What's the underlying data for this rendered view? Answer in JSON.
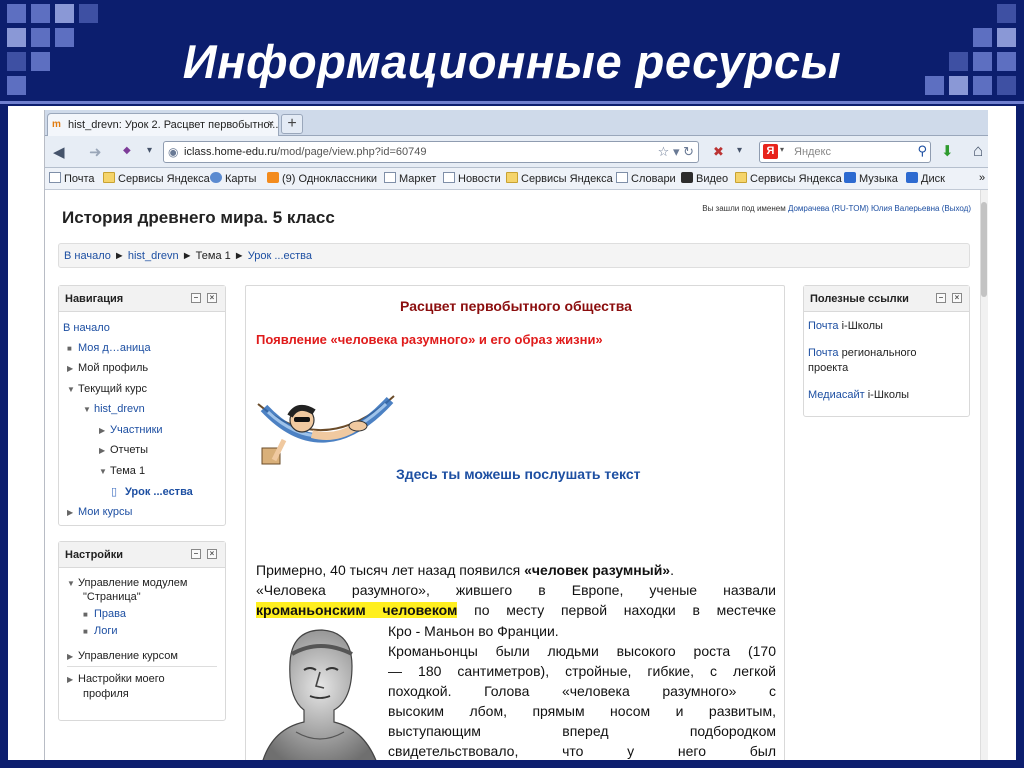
{
  "slide": {
    "title": "Информационные ресурсы"
  },
  "browser": {
    "tab_title": "hist_drevn: Урок 2. Расцвет первобытног...",
    "tab_favicon": "m",
    "new_tab_label": "+",
    "url_host": "iclass.home-edu.ru",
    "url_path": "/mod/page/view.php?id=60749",
    "search_engine_label": "Я",
    "search_placeholder": "Яндекс",
    "bookmarks": [
      {
        "label": "Почта",
        "icon": "page"
      },
      {
        "label": "Сервисы Яндекса",
        "icon": "folder"
      },
      {
        "label": "Карты",
        "icon": "globe"
      },
      {
        "label": "(9) Одноклассники",
        "icon": "ok"
      },
      {
        "label": "Маркет",
        "icon": "page"
      },
      {
        "label": "Новости",
        "icon": "page"
      },
      {
        "label": "Сервисы Яндекса",
        "icon": "folder"
      },
      {
        "label": "Словари",
        "icon": "page"
      },
      {
        "label": "Видео",
        "icon": "play"
      },
      {
        "label": "Сервисы Яндекса",
        "icon": "folder"
      },
      {
        "label": "Музыка",
        "icon": "blue"
      },
      {
        "label": "Диск",
        "icon": "blue"
      }
    ],
    "bookmarks_more": "»"
  },
  "site": {
    "title": "История древнего мира. 5 класс",
    "login_prefix": "Вы зашли под именем",
    "login_user": "Домрачева (RU-TOM) Юлия Валерьевна",
    "login_logout": "(Выход)"
  },
  "breadcrumb": {
    "home": "В начало",
    "course": "hist_drevn",
    "topic": "Тема 1",
    "lesson": "Урок ...ества",
    "sep": "►"
  },
  "navigation": {
    "title": "Навигация",
    "home": "В начало",
    "my_home": "Моя д…аница",
    "my_profile": "Мой профиль",
    "current_course": "Текущий курс",
    "course": "hist_drevn",
    "participants": "Участники",
    "reports": "Отчеты",
    "topic": "Тема 1",
    "lesson": "Урок ...ества",
    "my_courses": "Мои курсы"
  },
  "settings": {
    "title": "Настройки",
    "module_admin": "Управление модулем",
    "module_name": "\"Страница\"",
    "rights": "Права",
    "logs": "Логи",
    "course_admin": "Управление курсом",
    "profile_settings_1": "Настройки моего",
    "profile_settings_2": "профиля"
  },
  "useful_links": {
    "title": "Полезные ссылки",
    "link1": "Почта",
    "link1_rest": "i-Школы",
    "link2": "Почта",
    "link2_rest": "регионального",
    "link2_rest2": "проекта",
    "link3": "Медиасайт",
    "link3_rest": "i-Школы"
  },
  "lesson": {
    "title": "Расцвет первобытного общества",
    "subtitle": "Появление «человека разумного» и его образ жизни»",
    "listen": "Здесь ты можешь послушать текст",
    "p1_text": "Примерно, 40 тысяч лет назад появился ",
    "p1_bold": "«человек разумный»",
    "p1_end": ".",
    "p2_text": "«Человека разумного», жившего в Европе, ученые назвали",
    "p3_hl": "кроманьонским человеком",
    "p3_text": " по месту первой находки в местечке",
    "p4_text": "Кро - Маньон во Франции.",
    "p5_lines": [
      "Кроманьонцы были людьми высокого роста (170",
      "— 180 сантиметров), стройные, гибкие, с легкой",
      "походкой. Голова «человека разумного» с",
      "высоким лбом, прямым носом и развитым,",
      "выступающим вперед подбородком",
      "свидетельствовало, что у него был"
    ]
  },
  "icons": {
    "back": "◀",
    "forward": "➜",
    "home": "⌂",
    "download": "⬇",
    "star": "☆",
    "reload": "↻",
    "dropdown": "▾",
    "search": "⚲",
    "collapse": "–",
    "close": "×",
    "tab_close": "×",
    "globe": "◉"
  }
}
